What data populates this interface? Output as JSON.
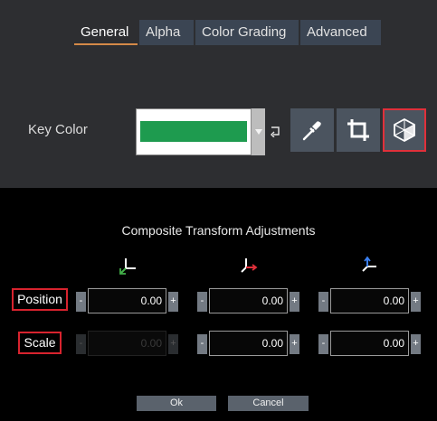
{
  "tabs": [
    {
      "label": "General",
      "active": true
    },
    {
      "label": "Alpha",
      "active": false
    },
    {
      "label": "Color Grading",
      "active": false
    },
    {
      "label": "Advanced",
      "active": false
    }
  ],
  "key_color": {
    "label": "Key Color",
    "swatch_color": "#1e9b4f"
  },
  "tools": [
    {
      "icon": "eyedropper-icon"
    },
    {
      "icon": "crop-icon"
    },
    {
      "icon": "cube-3d-icon",
      "highlighted": true
    }
  ],
  "dialog": {
    "title": "Composite Transform Adjustments",
    "axes": [
      "x-axis-icon",
      "y-axis-icon",
      "z-axis-icon"
    ],
    "rows": [
      {
        "label": "Position",
        "values": [
          {
            "minus": "-",
            "value": "0.00",
            "plus": "+",
            "enabled": true
          },
          {
            "minus": "-",
            "value": "0.00",
            "plus": "+",
            "enabled": true
          },
          {
            "minus": "-",
            "value": "0.00",
            "plus": "+",
            "enabled": true
          }
        ]
      },
      {
        "label": "Scale",
        "values": [
          {
            "minus": "-",
            "value": "0.00",
            "plus": "+",
            "enabled": false
          },
          {
            "minus": "-",
            "value": "0.00",
            "plus": "+",
            "enabled": true
          },
          {
            "minus": "-",
            "value": "0.00",
            "plus": "+",
            "enabled": true
          }
        ]
      }
    ],
    "ok_label": "Ok",
    "cancel_label": "Cancel"
  },
  "colors": {
    "highlight_border": "#d8232e",
    "active_tab_underline": "#d58a48",
    "axis_green": "#43b049",
    "axis_red": "#e0303a",
    "axis_blue": "#3a7ff0"
  }
}
